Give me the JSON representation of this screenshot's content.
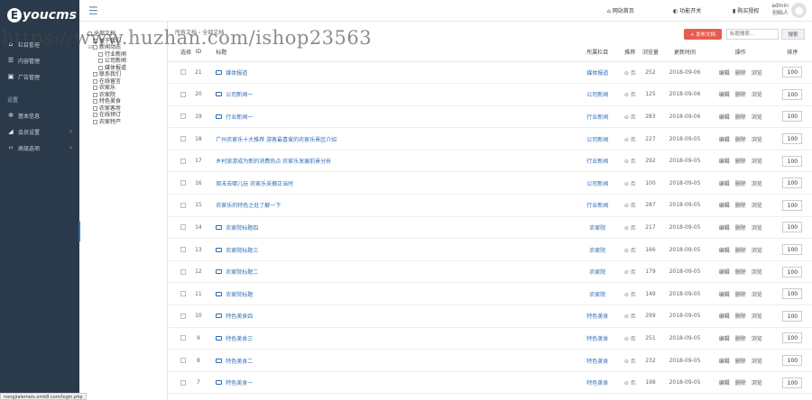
{
  "sidebar": {
    "logo_text": "youcms",
    "logo_letter": "E",
    "main_items": [
      {
        "icon": "home-icon",
        "glyph": "⌂",
        "label": "栏目管理"
      },
      {
        "icon": "list-icon",
        "glyph": "☰",
        "label": "内容管理"
      },
      {
        "icon": "image-icon",
        "glyph": "▣",
        "label": "广告管理"
      }
    ],
    "section_title": "设置",
    "setting_items": [
      {
        "icon": "gear-icon",
        "glyph": "✲",
        "label": "基本信息",
        "arrow": ""
      },
      {
        "icon": "send-icon",
        "glyph": "◢",
        "label": "会员设置",
        "arrow": "›"
      },
      {
        "icon": "code-icon",
        "glyph": "‹›",
        "label": "高级选项",
        "arrow": "›"
      }
    ]
  },
  "topbar": {
    "links": [
      {
        "icon": "home-icon",
        "glyph": "⌂",
        "label": "网站首页"
      },
      {
        "icon": "toggle-icon",
        "glyph": "◐",
        "label": "功能开关"
      },
      {
        "icon": "bookmark-icon",
        "glyph": "▮",
        "label": "购买授权"
      }
    ],
    "admin_name": "admin",
    "admin_role": "创始人"
  },
  "tree": {
    "items": [
      {
        "pm": "",
        "indent": 0,
        "label": "全部文档"
      },
      {
        "pm": "",
        "indent": 1,
        "label": "关于我们"
      },
      {
        "pm": "⊟",
        "indent": 1,
        "label": "新闻动态"
      },
      {
        "pm": "",
        "indent": 2,
        "label": "行业新闻"
      },
      {
        "pm": "",
        "indent": 2,
        "label": "公司新闻"
      },
      {
        "pm": "",
        "indent": 2,
        "label": "媒体报道"
      },
      {
        "pm": "",
        "indent": 1,
        "label": "联系我们"
      },
      {
        "pm": "",
        "indent": 1,
        "label": "在线留言"
      },
      {
        "pm": "",
        "indent": 1,
        "label": "农家乐"
      },
      {
        "pm": "",
        "indent": 1,
        "label": "农家院"
      },
      {
        "pm": "",
        "indent": 1,
        "label": "特色美食"
      },
      {
        "pm": "",
        "indent": 1,
        "label": "农家客房"
      },
      {
        "pm": "",
        "indent": 1,
        "label": "在线预订"
      },
      {
        "pm": "",
        "indent": 1,
        "label": "农家特产"
      }
    ]
  },
  "watermark": "https://www.huzhan.com/ishop23563",
  "content": {
    "breadcrumb": "所有文档 › 全部文档",
    "add_button": "+ 发布文档",
    "search_placeholder": "标题搜索...",
    "search_button": "搜索",
    "headers": {
      "select": "选择",
      "id": "ID",
      "title": "标题",
      "column": "所属栏目",
      "top": "推荐",
      "views": "浏览量",
      "updated": "更新时间",
      "ops": "操作",
      "sort": "排序"
    },
    "rows": [
      {
        "id": "21",
        "title": "媒体报道",
        "column": "媒体报道",
        "top": "否",
        "views": "252",
        "date": "2018-09-06",
        "img": true
      },
      {
        "id": "20",
        "title": "公司新闻一",
        "column": "公司新闻",
        "top": "否",
        "views": "125",
        "date": "2018-09-06",
        "img": true
      },
      {
        "id": "19",
        "title": "行业新闻一",
        "column": "行业新闻",
        "top": "否",
        "views": "283",
        "date": "2018-09-06",
        "img": true
      },
      {
        "id": "18",
        "title": "广州农家乐十大推荐 游客最喜爱的农家乐景区介绍",
        "column": "公司新闻",
        "top": "否",
        "views": "227",
        "date": "2018-09-05",
        "img": false
      },
      {
        "id": "17",
        "title": "乡村旅游成为新的消费热点 农家乐发展前景分析",
        "column": "行业新闻",
        "top": "否",
        "views": "292",
        "date": "2018-09-05",
        "img": false
      },
      {
        "id": "16",
        "title": "周末去哪儿玩 农家乐采摘正当时",
        "column": "公司新闻",
        "top": "否",
        "views": "100",
        "date": "2018-09-05",
        "img": false
      },
      {
        "id": "15",
        "title": "农家乐的特色之处了解一下",
        "column": "行业新闻",
        "top": "否",
        "views": "287",
        "date": "2018-09-05",
        "img": false
      },
      {
        "id": "14",
        "title": "农家院标题四",
        "column": "农家院",
        "top": "否",
        "views": "217",
        "date": "2018-09-05",
        "img": true
      },
      {
        "id": "13",
        "title": "农家院标题三",
        "column": "农家院",
        "top": "否",
        "views": "166",
        "date": "2018-09-05",
        "img": true
      },
      {
        "id": "12",
        "title": "农家院标题二",
        "column": "农家院",
        "top": "否",
        "views": "179",
        "date": "2018-09-05",
        "img": true
      },
      {
        "id": "11",
        "title": "农家院标题",
        "column": "农家院",
        "top": "否",
        "views": "149",
        "date": "2018-09-05",
        "img": true
      },
      {
        "id": "10",
        "title": "特色美食四",
        "column": "特色美食",
        "top": "否",
        "views": "299",
        "date": "2018-09-05",
        "img": true
      },
      {
        "id": "9",
        "title": "特色美食三",
        "column": "特色美食",
        "top": "否",
        "views": "251",
        "date": "2018-09-05",
        "img": true
      },
      {
        "id": "8",
        "title": "特色美食二",
        "column": "特色美食",
        "top": "否",
        "views": "232",
        "date": "2018-09-05",
        "img": true
      },
      {
        "id": "7",
        "title": "特色美食一",
        "column": "特色美食",
        "top": "否",
        "views": "198",
        "date": "2018-09-05",
        "img": true
      }
    ],
    "op_labels": [
      "编辑",
      "删除",
      "浏览"
    ],
    "sort_value": "100"
  },
  "status_url": "nongjialemeis.xmk8.com/login.php",
  "colors": {
    "sidebar_bg": "#2b3a4a",
    "accent_blue": "#2e6db4",
    "add_button": "#e55d4f"
  }
}
